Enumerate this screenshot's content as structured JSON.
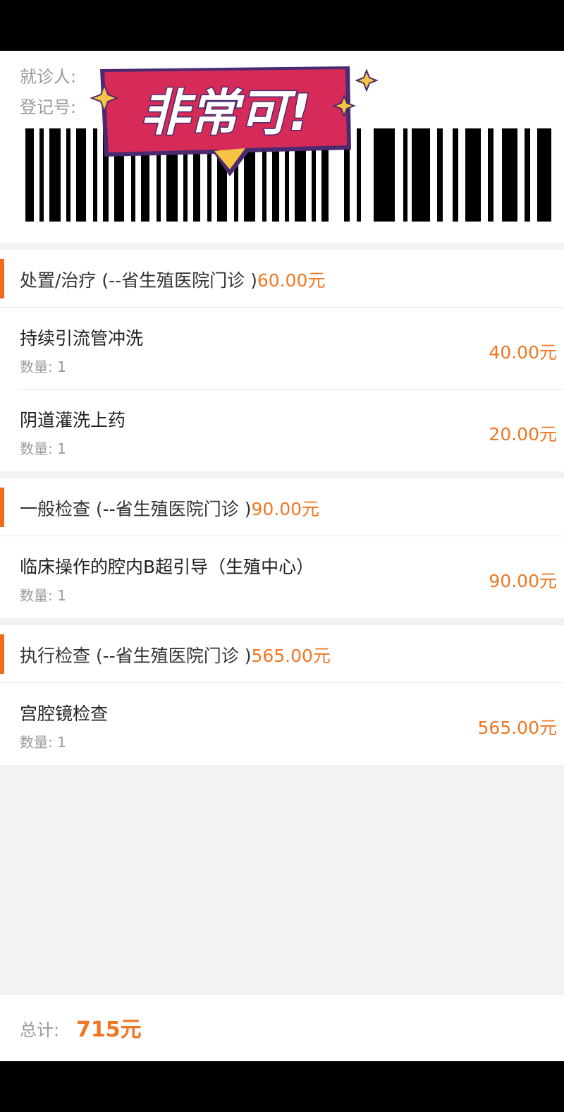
{
  "patient": {
    "patient_label": "就诊人:",
    "reg_label": "登记号:"
  },
  "sticker": {
    "text": "非常可!"
  },
  "sections": [
    {
      "title": "处置/治疗 (--省生殖医院门诊 )",
      "amount": "60.00元",
      "items": [
        {
          "name": "持续引流管冲洗",
          "qty_label": "数量:",
          "qty": "1",
          "price": "40.00元"
        },
        {
          "name": "阴道灌洗上药",
          "qty_label": "数量:",
          "qty": "1",
          "price": "20.00元"
        }
      ]
    },
    {
      "title": "一般检查 (--省生殖医院门诊 )",
      "amount": "90.00元",
      "items": [
        {
          "name": "临床操作的腔内B超引导（生殖中心）",
          "qty_label": "数量:",
          "qty": "1",
          "price": "90.00元"
        }
      ]
    },
    {
      "title": "执行检查 (--省生殖医院门诊 )",
      "amount": "565.00元",
      "items": [
        {
          "name": "宫腔镜检查",
          "qty_label": "数量:",
          "qty": "1",
          "price": "565.00元"
        }
      ]
    }
  ],
  "footer": {
    "total_label": "总计:",
    "total": "715元"
  },
  "colors": {
    "accent": "#ee7722",
    "section_bar": "#f26b1d",
    "sticker_bg": "#d62b58",
    "sticker_border": "#4a2a6e",
    "star": "#f6c343"
  }
}
